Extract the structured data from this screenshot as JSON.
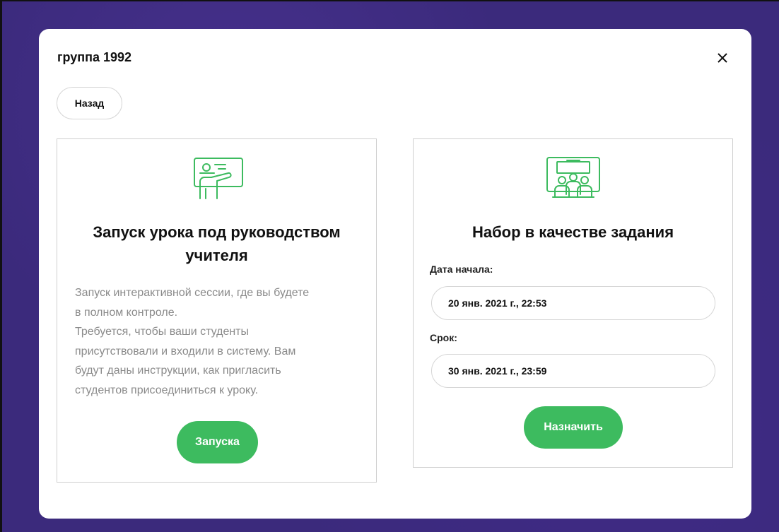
{
  "modal": {
    "title": "группа 1992",
    "back_label": "Назад"
  },
  "left_card": {
    "icon": "teacher-presentation-icon",
    "title": "Запуск урока под руководством учителя",
    "description_lines": [
      "Запуск интерактивной сессии, где вы будете",
      "в полном контроле.",
      "Требуется, чтобы ваши студенты",
      "присутствовали и входили в систему. Вам",
      "будут даны инструкции, как пригласить",
      "студентов присоединиться к уроку."
    ],
    "button_label": "Запуска"
  },
  "right_card": {
    "icon": "class-students-icon",
    "title": "Набор в качестве задания",
    "start_label": "Дата начала:",
    "start_value": "20 янв. 2021 г., 22:53",
    "due_label": "Срок:",
    "due_value": "30 янв. 2021 г., 23:59",
    "button_label": "Назначить"
  },
  "colors": {
    "accent_green": "#3dbb5f",
    "backdrop_purple": "#3b2a7c"
  }
}
